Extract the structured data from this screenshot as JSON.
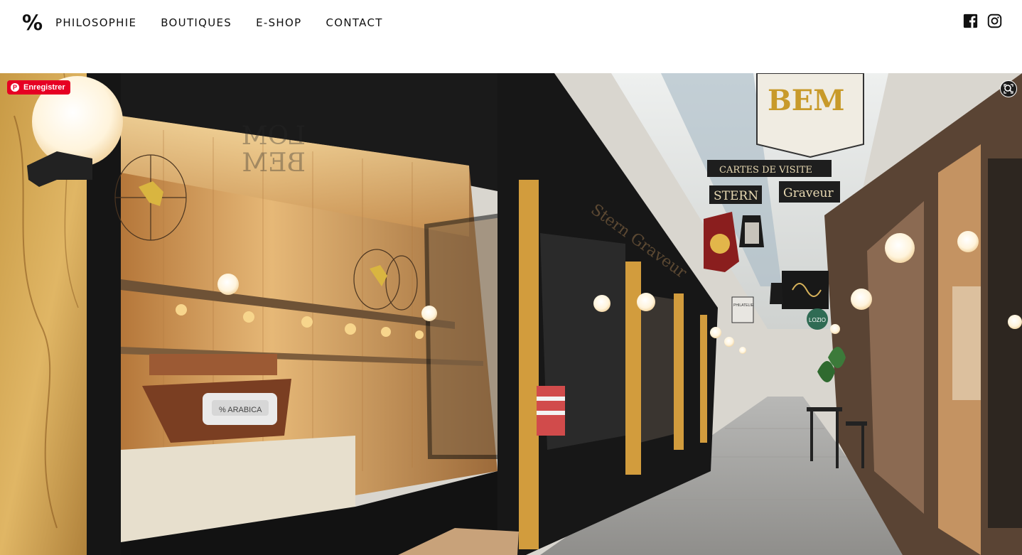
{
  "header": {
    "logo_text": "%",
    "nav": [
      {
        "label": "PHILOSOPHIE"
      },
      {
        "label": "BOUTIQUES"
      },
      {
        "label": "E-SHOP"
      },
      {
        "label": "CONTACT"
      }
    ],
    "social": [
      {
        "icon": "facebook-icon"
      },
      {
        "icon": "instagram-icon"
      }
    ]
  },
  "hero": {
    "pin_label": "Enregistrer",
    "signs": {
      "bem": "BEM",
      "cartes": "CARTES DE VISITE",
      "stern": "STERN",
      "graveur": "Graveur",
      "lom": "LOM",
      "bem_reflect": "BEM",
      "machine": "% ARABICA",
      "lozio": "LOZIO",
      "philatelie": "PHILATELIE",
      "shop_name": "Stern Graveur"
    }
  },
  "colors": {
    "accent": "#e60023",
    "text": "#111111"
  }
}
